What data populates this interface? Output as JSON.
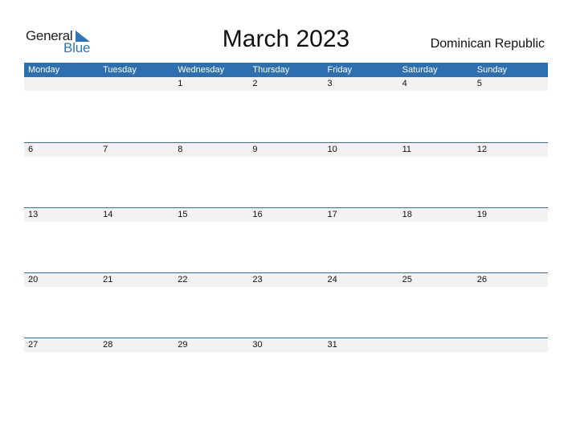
{
  "logo": {
    "part1": "General",
    "part2": "Blue"
  },
  "title": "March 2023",
  "country": "Dominican Republic",
  "colors": {
    "accent": "#2e6fb0",
    "row_bg": "#f2f2f2"
  },
  "weekdays": [
    "Monday",
    "Tuesday",
    "Wednesday",
    "Thursday",
    "Friday",
    "Saturday",
    "Sunday"
  ],
  "weeks": [
    [
      "",
      "",
      "1",
      "2",
      "3",
      "4",
      "5"
    ],
    [
      "6",
      "7",
      "8",
      "9",
      "10",
      "11",
      "12"
    ],
    [
      "13",
      "14",
      "15",
      "16",
      "17",
      "18",
      "19"
    ],
    [
      "20",
      "21",
      "22",
      "23",
      "24",
      "25",
      "26"
    ],
    [
      "27",
      "28",
      "29",
      "30",
      "31",
      "",
      ""
    ]
  ]
}
